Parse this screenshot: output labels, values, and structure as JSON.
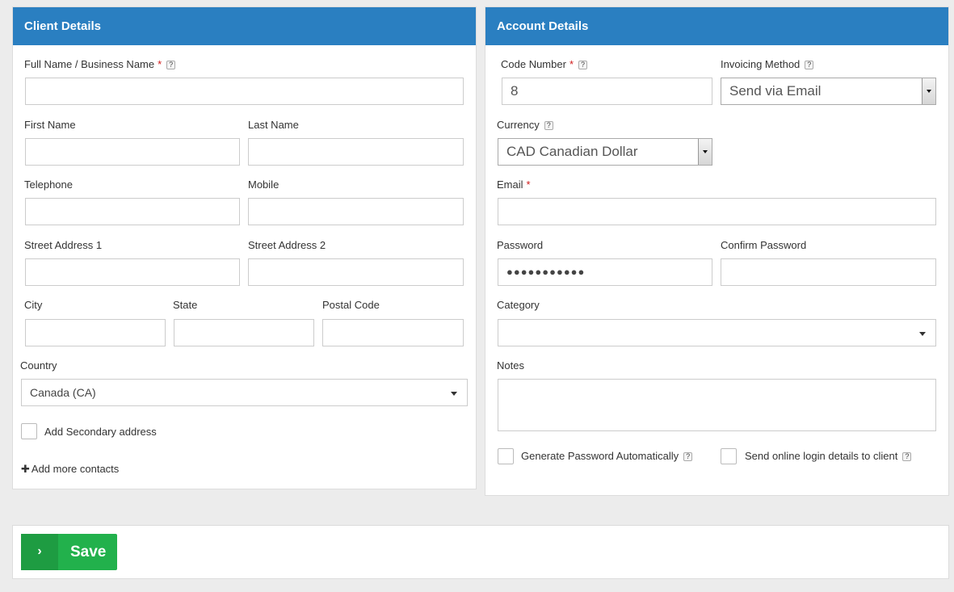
{
  "client": {
    "title": "Client Details",
    "full_name_label": "Full Name / Business Name",
    "full_name_value": "",
    "first_name_label": "First Name",
    "first_name_value": "",
    "last_name_label": "Last Name",
    "last_name_value": "",
    "telephone_label": "Telephone",
    "telephone_value": "",
    "mobile_label": "Mobile",
    "mobile_value": "",
    "street1_label": "Street Address 1",
    "street1_value": "",
    "street2_label": "Street Address 2",
    "street2_value": "",
    "city_label": "City",
    "city_value": "",
    "state_label": "State",
    "state_value": "",
    "postal_label": "Postal Code",
    "postal_value": "",
    "country_label": "Country",
    "country_value": "Canada (CA)",
    "secondary_address_label": "Add Secondary address",
    "add_contacts_label": "Add more contacts"
  },
  "account": {
    "title": "Account Details",
    "code_label": "Code Number",
    "code_value": "8",
    "invoicing_label": "Invoicing Method",
    "invoicing_value": "Send via Email",
    "currency_label": "Currency",
    "currency_value": "CAD Canadian Dollar",
    "email_label": "Email",
    "email_value": "",
    "password_label": "Password",
    "password_value": "●●●●●●●●●●●",
    "confirm_label": "Confirm Password",
    "confirm_value": "",
    "category_label": "Category",
    "category_value": "",
    "notes_label": "Notes",
    "notes_value": "",
    "generate_pw_label": "Generate Password Automatically",
    "send_login_label": "Send online login details to client"
  },
  "common": {
    "required_mark": "*",
    "help_mark": "?"
  },
  "actions": {
    "save_label": "Save",
    "save_icon": "chevron-right-icon"
  },
  "colors": {
    "header_blue": "#2a7fc1",
    "save_green": "#22b14c",
    "required_red": "#d01818"
  }
}
